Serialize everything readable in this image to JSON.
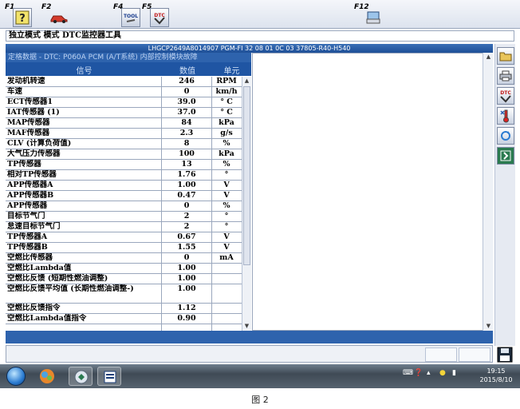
{
  "toolbar": {
    "f1": "F1",
    "f2": "F2",
    "f4": "F4",
    "f5": "F5",
    "f12": "F12",
    "f4_icon_text": "TOOL",
    "f5_icon_text": "DTC"
  },
  "mode_bar": "独立模式 模式 DTC监控器工具",
  "vin_line": "LHGCP2649A8014907  PGM-FI  32 08 01 0C 03  37805-R40-H540",
  "panel_title": "定格数据 - DTC: P060A    PCM (A/T系统) 内部控制模块故障",
  "columns": {
    "signal": "信号",
    "value": "数值",
    "unit": "单元"
  },
  "rows": [
    {
      "name": "发动机转速",
      "value": "246",
      "unit": "RPM"
    },
    {
      "name": "车速",
      "value": "0",
      "unit": "km/h"
    },
    {
      "name": "ECT传感器1",
      "value": "39.0",
      "unit": "° C"
    },
    {
      "name": "IAT传感器 (1)",
      "value": "37.0",
      "unit": "° C"
    },
    {
      "name": "MAP传感器",
      "value": "84",
      "unit": "kPa"
    },
    {
      "name": "MAF传感器",
      "value": "2.3",
      "unit": "g/s"
    },
    {
      "name": "CLV (计算负荷值)",
      "value": "8",
      "unit": "%"
    },
    {
      "name": "大气压力传感器",
      "value": "100",
      "unit": "kPa"
    },
    {
      "name": "TP传感器",
      "value": "13",
      "unit": "%"
    },
    {
      "name": "相对TP传感器",
      "value": "1.76",
      "unit": "°"
    },
    {
      "name": "APP传感器A",
      "value": "1.00",
      "unit": "V"
    },
    {
      "name": "APP传感器B",
      "value": "0.47",
      "unit": "V"
    },
    {
      "name": "APP传感器",
      "value": "0",
      "unit": "%"
    },
    {
      "name": "目标节气门",
      "value": "2",
      "unit": "°"
    },
    {
      "name": "怠速目标节气门",
      "value": "2",
      "unit": "°"
    },
    {
      "name": "TP传感器A",
      "value": "0.67",
      "unit": "V"
    },
    {
      "name": "TP传感器B",
      "value": "1.55",
      "unit": "V"
    },
    {
      "name": "空燃比传感器",
      "value": "0",
      "unit": "mA"
    },
    {
      "name": "空燃比Lambda值",
      "value": "1.00",
      "unit": ""
    },
    {
      "name": "空燃比反馈 (短期性燃油调整)",
      "value": "1.00",
      "unit": ""
    },
    {
      "name": "空燃比反馈平均值 (长期性燃油调整-)",
      "value": "1.00",
      "unit": ""
    },
    {
      "name": "空燃比反馈指令",
      "value": "1.12",
      "unit": ""
    },
    {
      "name": "空燃比Lambda值指令",
      "value": "0.90",
      "unit": ""
    }
  ],
  "side_buttons": [
    "open-folder-icon",
    "print-icon",
    "dtc-clear-icon",
    "thermometer-icon",
    "refresh-icon",
    "exit-icon"
  ],
  "dtc_icon_text": "DTC",
  "clock": {
    "time": "19:15",
    "date": "2015/8/10"
  },
  "caption": "图 2"
}
